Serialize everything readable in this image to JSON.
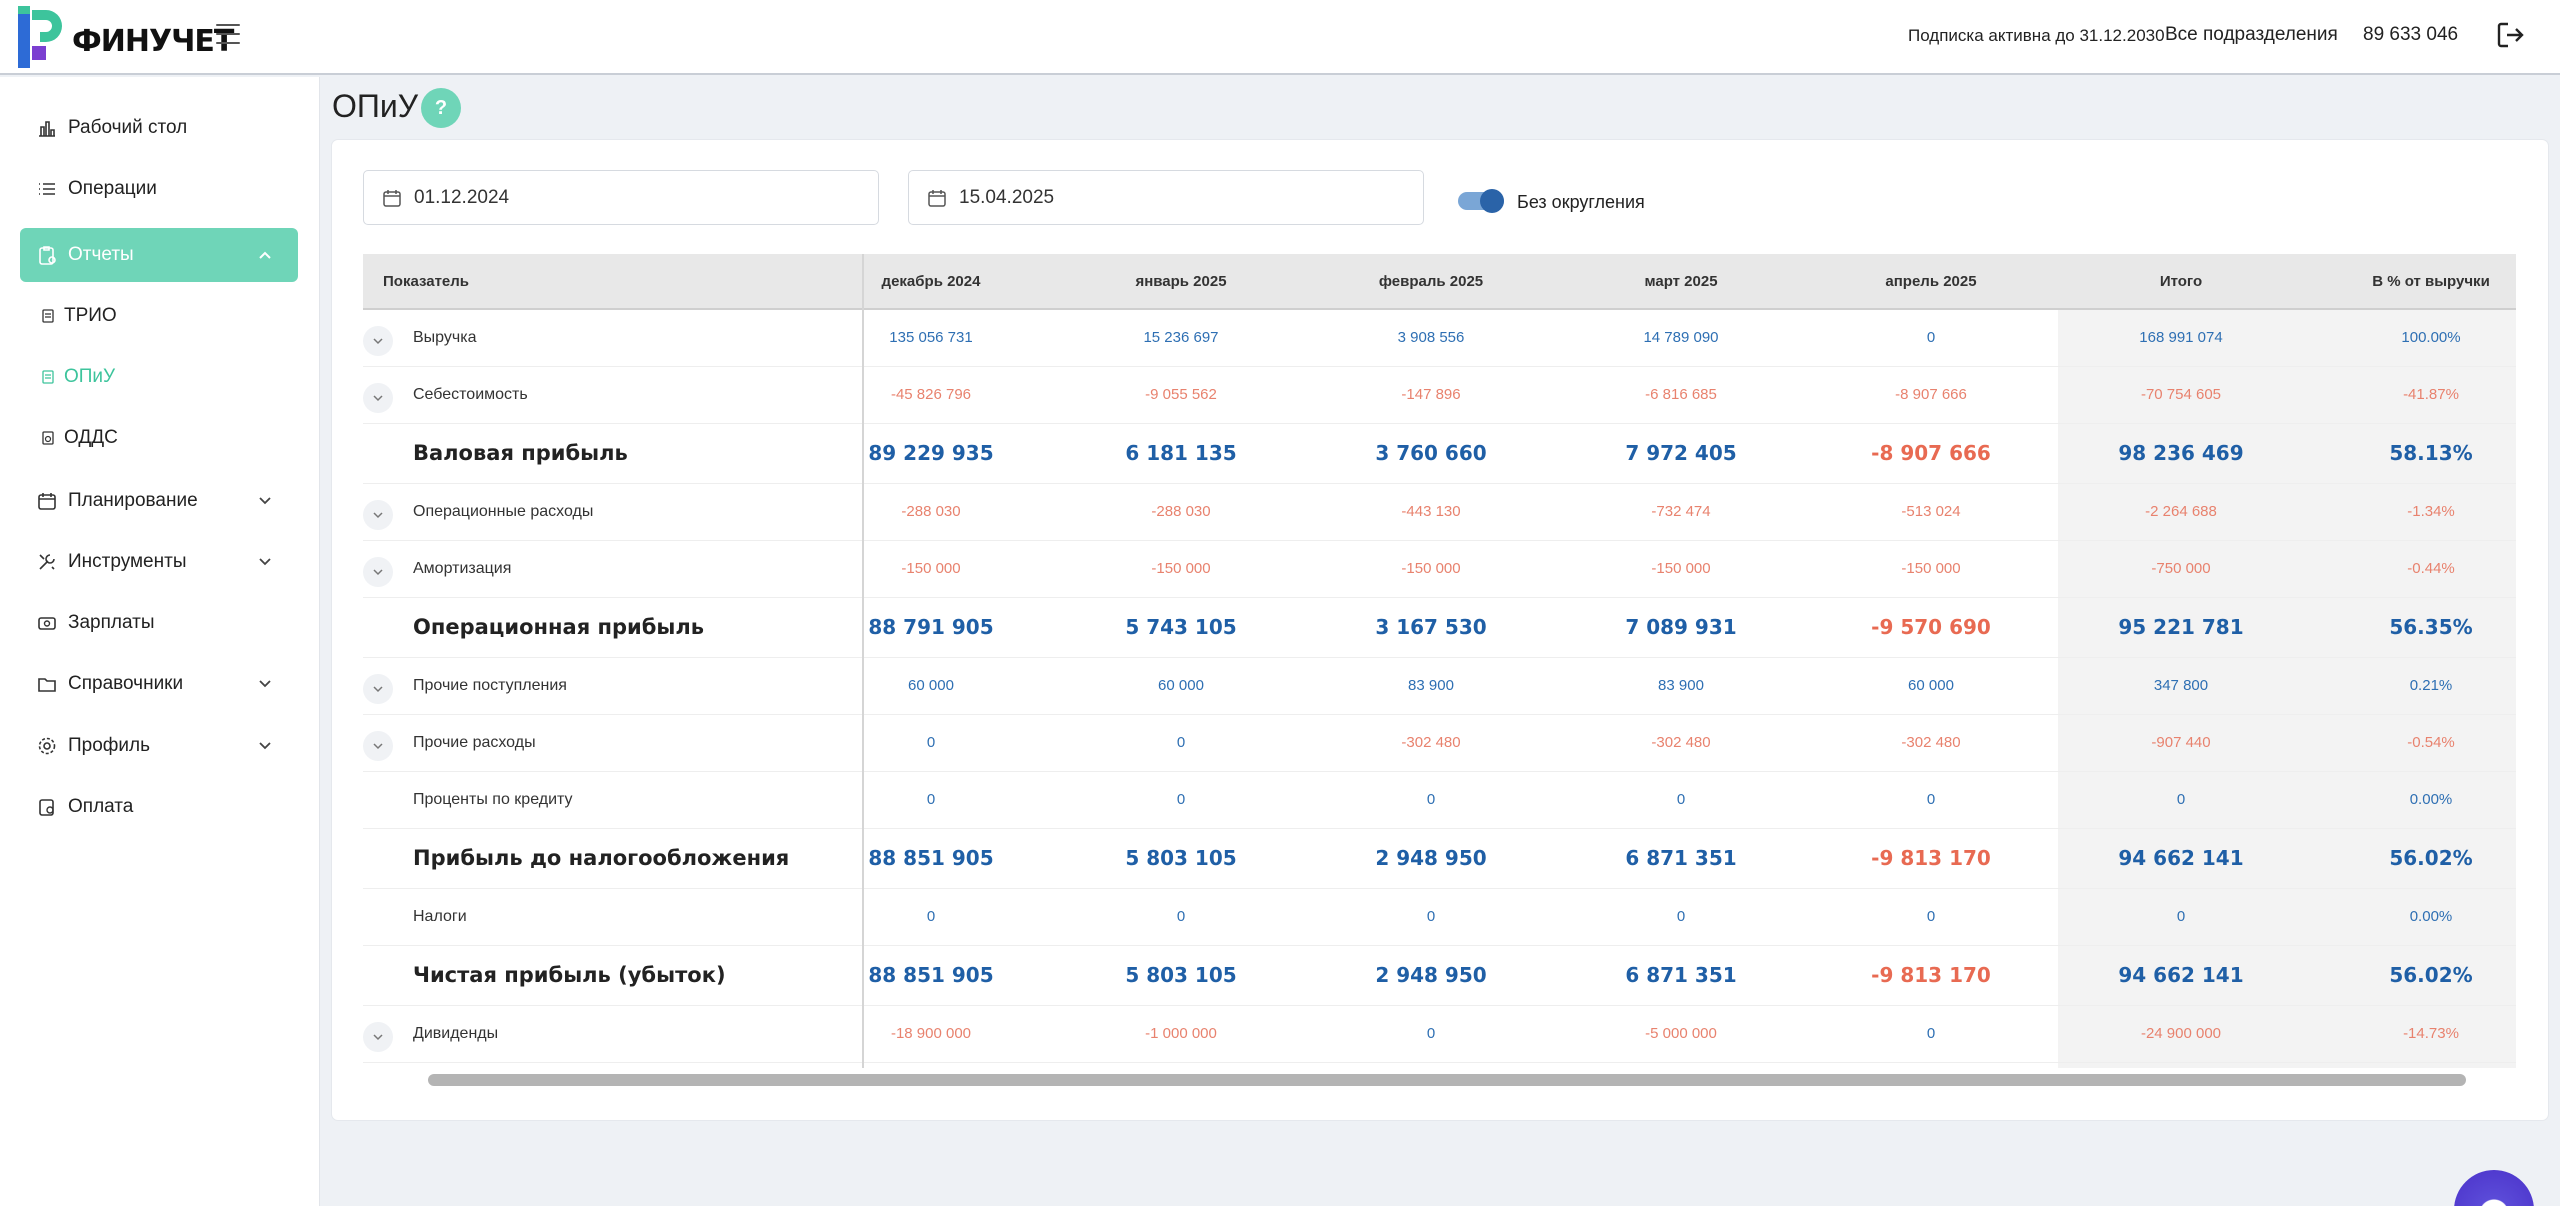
{
  "header": {
    "logo_text": "ФИНУЧЕТ",
    "subscription": "Подписка активна до 31.12.2030",
    "division": "Все подразделения",
    "phone": "89 633 046"
  },
  "sidebar": {
    "items": [
      {
        "label": "Рабочий стол",
        "icon": "chart-bar-icon"
      },
      {
        "label": "Операции",
        "icon": "list-icon"
      },
      {
        "label": "Отчеты",
        "icon": "clipboard-icon"
      },
      {
        "label": "Планирование",
        "icon": "calendar-icon"
      },
      {
        "label": "Инструменты",
        "icon": "tools-icon"
      },
      {
        "label": "Зарплаты",
        "icon": "money-icon"
      },
      {
        "label": "Справочники",
        "icon": "folder-icon"
      },
      {
        "label": "Профиль",
        "icon": "gear-icon"
      },
      {
        "label": "Оплата",
        "icon": "wallet-icon"
      }
    ],
    "sub_items": [
      {
        "label": "ТРИО"
      },
      {
        "label": "ОПиУ"
      },
      {
        "label": "ОДДС"
      }
    ]
  },
  "page": {
    "title": "ОПиУ",
    "help": "?",
    "date_from": "01.12.2024",
    "date_to": "15.04.2025",
    "toggle_label": "Без округления"
  },
  "table": {
    "headers": [
      "Показатель",
      "декабрь 2024",
      "январь 2025",
      "февраль 2025",
      "март 2025",
      "апрель 2025",
      "Итого",
      "В % от выручки"
    ],
    "rows": [
      {
        "label": "Выручка",
        "bold": false,
        "expand": true,
        "values": [
          "135 056 731",
          "15 236 697",
          "3 908 556",
          "14 789 090",
          "0",
          "168 991 074",
          "100.00%"
        ]
      },
      {
        "label": "Себестоимость",
        "bold": false,
        "expand": true,
        "values": [
          "-45 826 796",
          "-9 055 562",
          "-147 896",
          "-6 816 685",
          "-8 907 666",
          "-70 754 605",
          "-41.87%"
        ]
      },
      {
        "label": "Валовая прибыль",
        "bold": true,
        "expand": false,
        "values": [
          "89 229 935",
          "6 181 135",
          "3 760 660",
          "7 972 405",
          "-8 907 666",
          "98 236 469",
          "58.13%"
        ]
      },
      {
        "label": "Операционные расходы",
        "bold": false,
        "expand": true,
        "values": [
          "-288 030",
          "-288 030",
          "-443 130",
          "-732 474",
          "-513 024",
          "-2 264 688",
          "-1.34%"
        ]
      },
      {
        "label": "Амортизация",
        "bold": false,
        "expand": true,
        "values": [
          "-150 000",
          "-150 000",
          "-150 000",
          "-150 000",
          "-150 000",
          "-750 000",
          "-0.44%"
        ]
      },
      {
        "label": "Операционная прибыль",
        "bold": true,
        "expand": false,
        "values": [
          "88 791 905",
          "5 743 105",
          "3 167 530",
          "7 089 931",
          "-9 570 690",
          "95 221 781",
          "56.35%"
        ]
      },
      {
        "label": "Прочие поступления",
        "bold": false,
        "expand": true,
        "values": [
          "60 000",
          "60 000",
          "83 900",
          "83 900",
          "60 000",
          "347 800",
          "0.21%"
        ]
      },
      {
        "label": "Прочие расходы",
        "bold": false,
        "expand": true,
        "values": [
          "0",
          "0",
          "-302 480",
          "-302 480",
          "-302 480",
          "-907 440",
          "-0.54%"
        ]
      },
      {
        "label": "Проценты по кредиту",
        "bold": false,
        "expand": false,
        "values": [
          "0",
          "0",
          "0",
          "0",
          "0",
          "0",
          "0.00%"
        ]
      },
      {
        "label": "Прибыль до налогообложения",
        "bold": true,
        "expand": false,
        "values": [
          "88 851 905",
          "5 803 105",
          "2 948 950",
          "6 871 351",
          "-9 813 170",
          "94 662 141",
          "56.02%"
        ]
      },
      {
        "label": "Налоги",
        "bold": false,
        "expand": false,
        "values": [
          "0",
          "0",
          "0",
          "0",
          "0",
          "0",
          "0.00%"
        ]
      },
      {
        "label": "Чистая прибыль (убыток)",
        "bold": true,
        "expand": false,
        "values": [
          "88 851 905",
          "5 803 105",
          "2 948 950",
          "6 871 351",
          "-9 813 170",
          "94 662 141",
          "56.02%"
        ]
      },
      {
        "label": "Дивиденды",
        "bold": false,
        "expand": true,
        "values": [
          "-18 900 000",
          "-1 000 000",
          "0",
          "-5 000 000",
          "0",
          "-24 900 000",
          "-14.73%"
        ]
      }
    ]
  }
}
